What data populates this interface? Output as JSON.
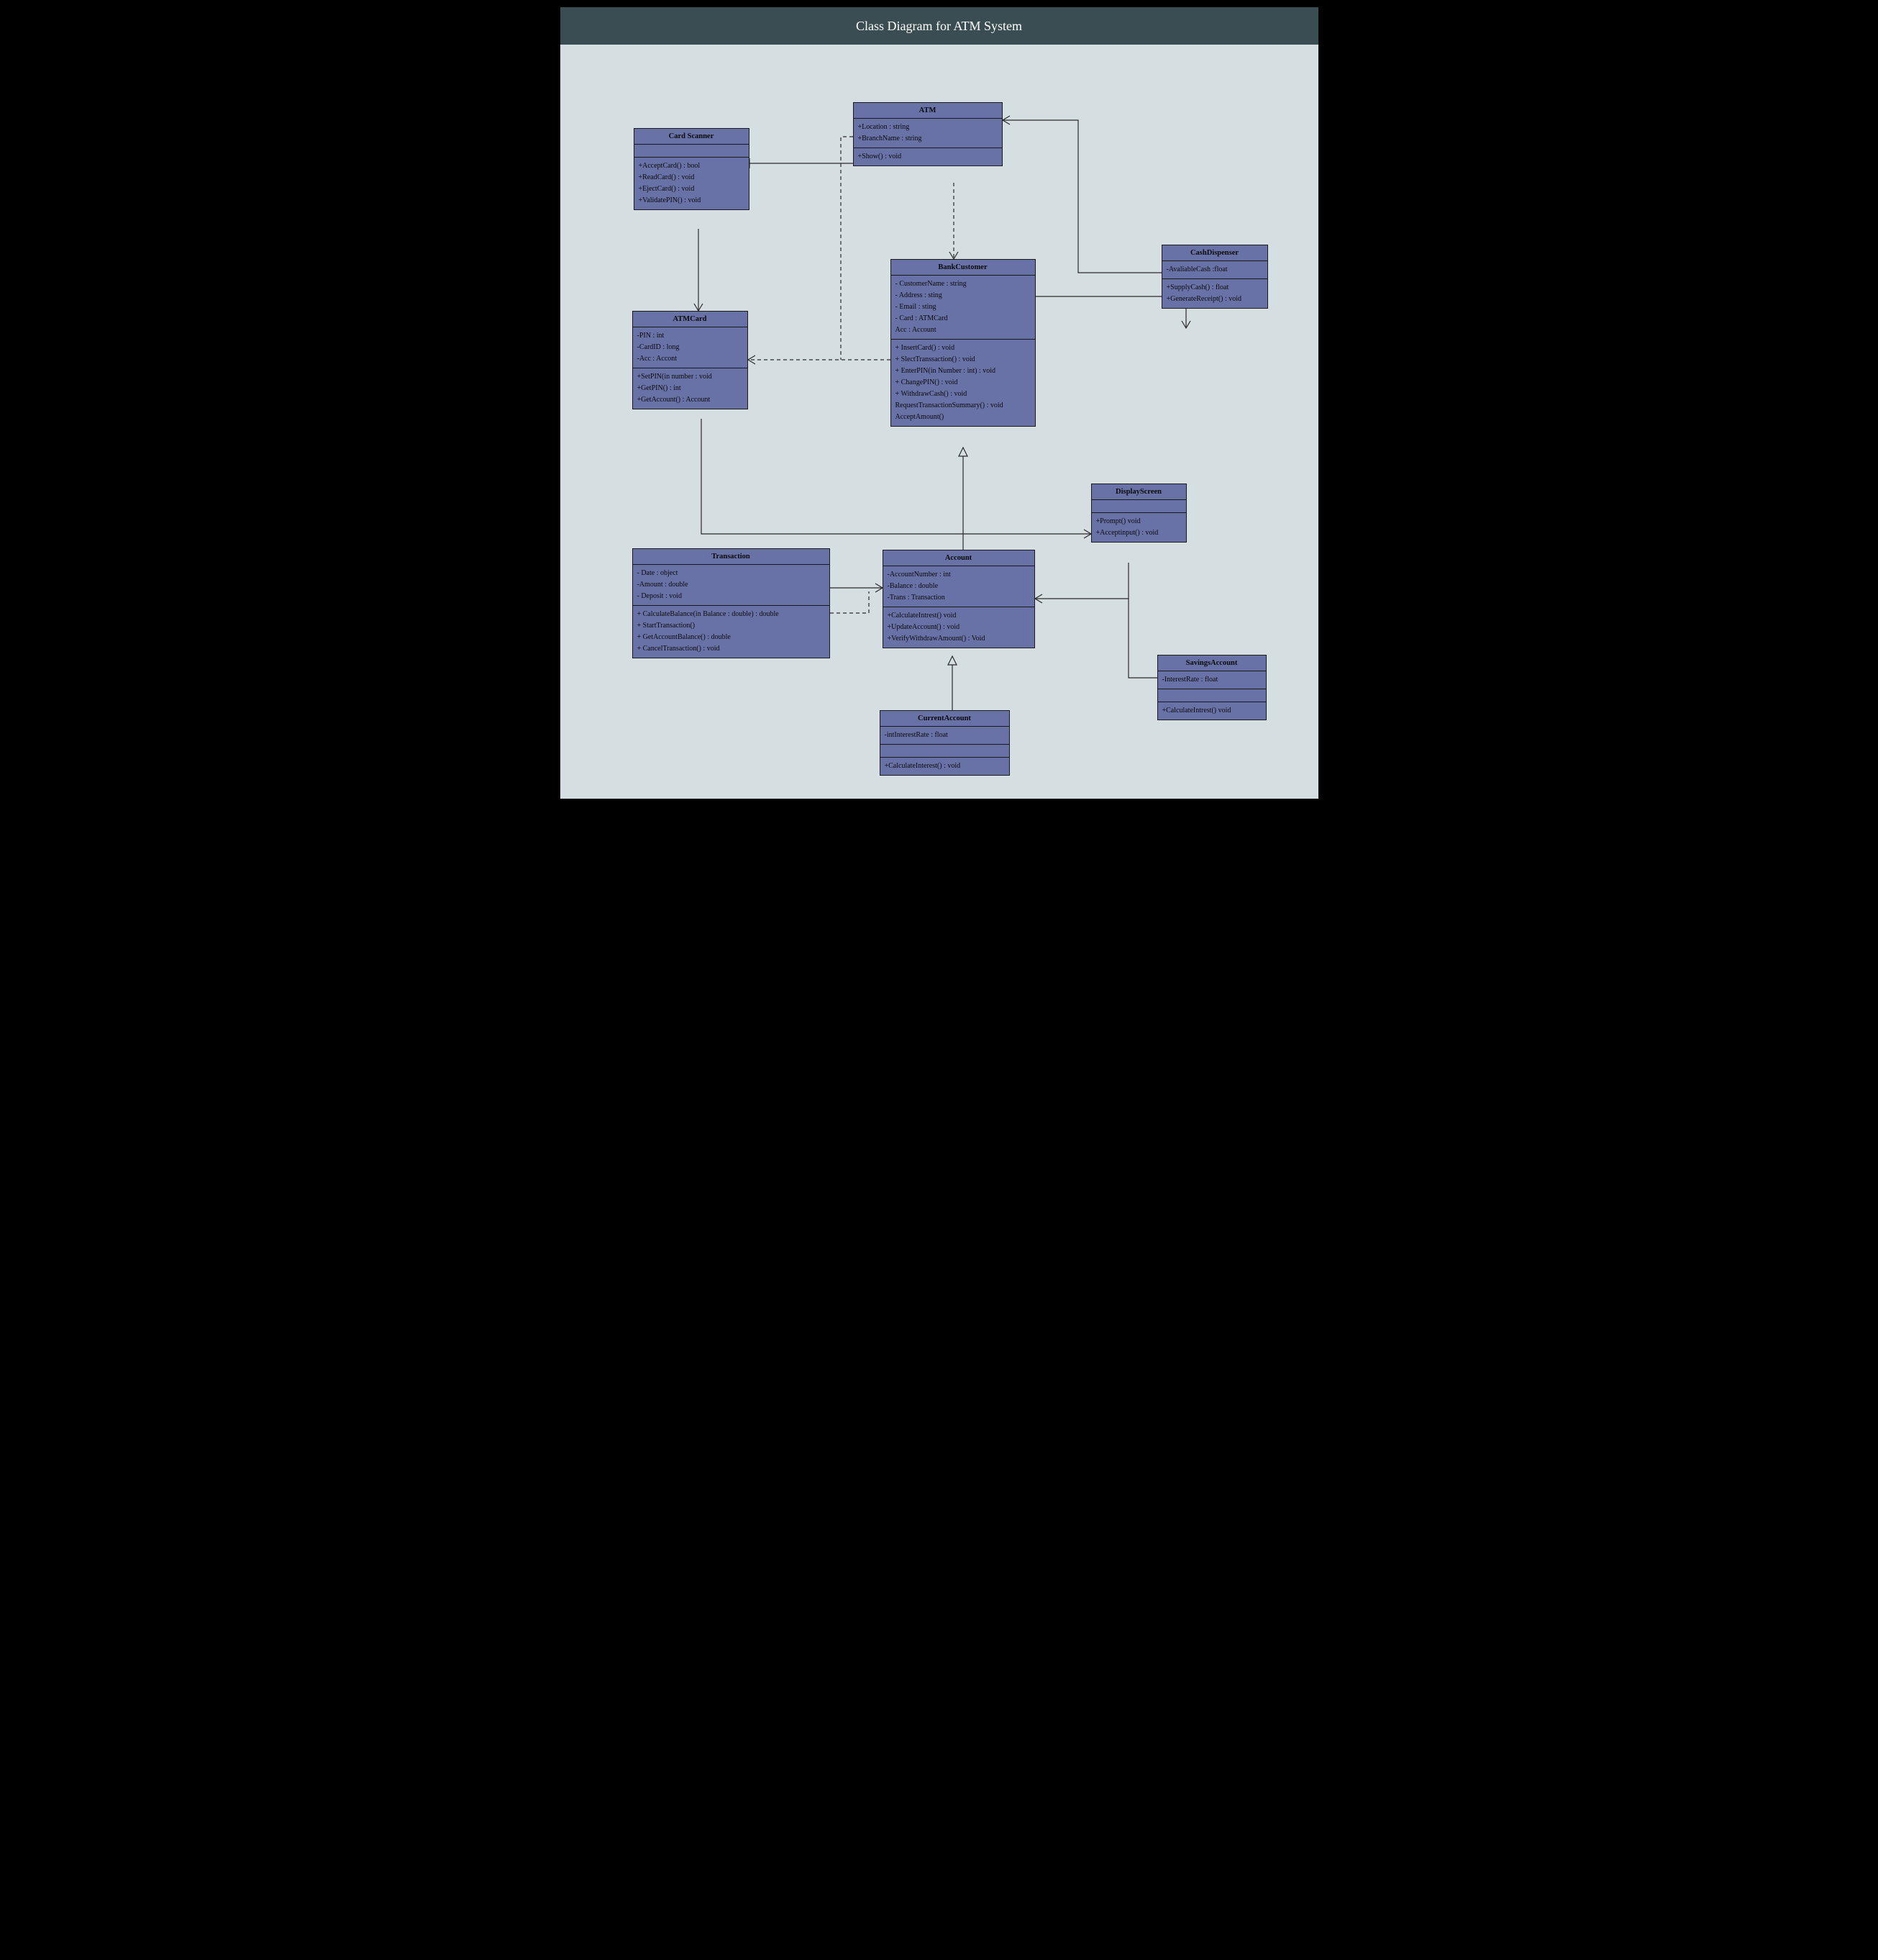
{
  "title": "Class Diagram for ATM System",
  "classes": {
    "cardScanner": {
      "name": "Card Scanner",
      "attrs": "",
      "ops": "+AcceptCard() : bool\n+ReadCard() : void\n+EjectCard() : void\n+ValidatePIN() : void"
    },
    "atm": {
      "name": "ATM",
      "attrs": "+Location : string\n+BranchName : string",
      "ops": "+Show() : void"
    },
    "cashDispenser": {
      "name": "CashDispenser",
      "attrs": "-AvaliableCash :float",
      "ops": "+SupplyCash() : float\n+GenerateReceipt() : void"
    },
    "atmCard": {
      "name": "ATMCard",
      "attrs": "-PIN : int\n-CardID : long\n-Acc : Accont",
      "ops": "+SetPIN(in number : void\n+GetPIN() : int\n+GetAccount() : Account"
    },
    "bankCustomer": {
      "name": "BankCustomer",
      "attrs": "- CustomerName : string\n- Address : sting\n- Email : sting\n- Card : ATMCard\nAcc : Account",
      "ops": "+ InsertCard() : void\n+ SlectTranssaction() : void\n+ EnterPIN(in Number : int) : void\n+ ChangePIN() : void\n+ WithdrawCash() : void\nRequestTransactionSummary() : void\nAcceptAmount()"
    },
    "displayScreen": {
      "name": "DisplayScreen",
      "attrs": "",
      "ops": "+Prompt() void\n+Acceptinput() : void"
    },
    "transaction": {
      "name": "Transaction",
      "attrs": "- Date : object\n-Amount : double\n- Deposit : void",
      "ops": "+ CalculateBalance(in Balance : double) : double\n+ StartTransaction()\n+ GetAccountBalance() : double\n+ CancelTransaction() : void"
    },
    "account": {
      "name": "Account",
      "attrs": "-AccountNumber : int\n-Balance : double\n-Trans : Transaction",
      "ops": "+CalculateIntrest() void\n+UpdateAccount() : void\n+VerifyWithdrawAmount() :  Void"
    },
    "currentAccount": {
      "name": "CurrentAccount",
      "attrs": "-intInterestRate : float",
      "ops": "+CalculateInterest() : void"
    },
    "savingsAccount": {
      "name": "SavingsAccount",
      "attrs": "-InterestRate : float",
      "ops": "+CalculateIntrest() void"
    }
  }
}
